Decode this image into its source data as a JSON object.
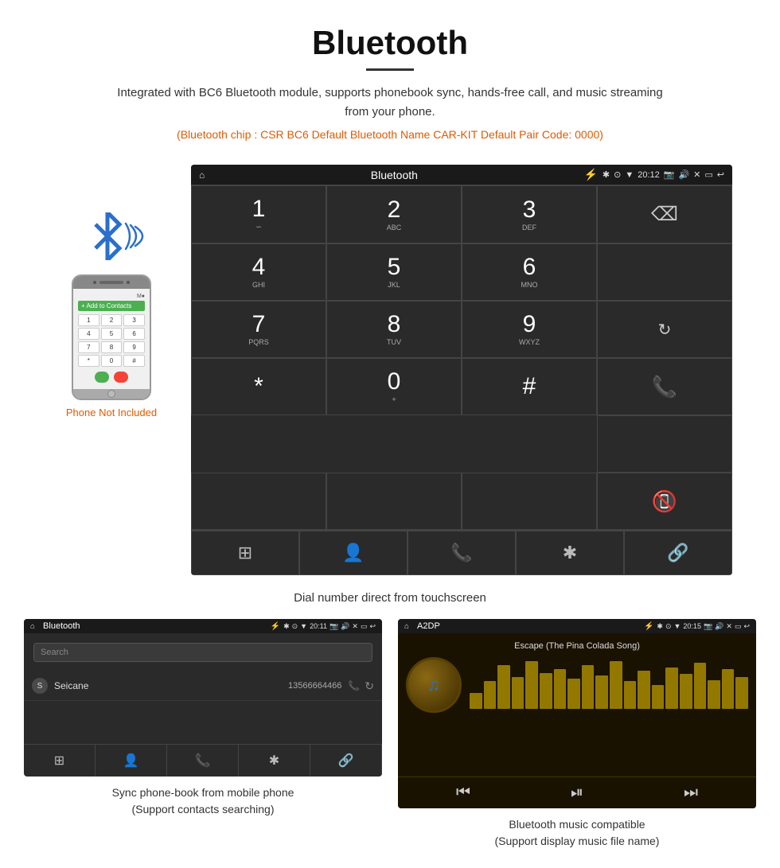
{
  "page": {
    "title": "Bluetooth",
    "subtitle": "Integrated with BC6 Bluetooth module, supports phonebook sync, hands-free call, and music streaming from your phone.",
    "specs": "(Bluetooth chip : CSR BC6    Default Bluetooth Name CAR-KIT    Default Pair Code: 0000)",
    "dial_caption": "Dial number direct from touchscreen",
    "phonebook_caption": "Sync phone-book from mobile phone\n(Support contacts searching)",
    "music_caption": "Bluetooth music compatible\n(Support display music file name)"
  },
  "android_screen": {
    "status_bar": {
      "home_icon": "⌂",
      "title": "Bluetooth",
      "usb_icon": "⚡",
      "bt_icon": "✱",
      "location_icon": "⊙",
      "signal_icon": "▼",
      "time": "20:12",
      "camera_icon": "📷",
      "volume_icon": "🔊",
      "x_icon": "✕",
      "window_icon": "▭",
      "back_icon": "↩"
    },
    "dial_keys": [
      {
        "number": "1",
        "sub": "∽"
      },
      {
        "number": "2",
        "sub": "ABC"
      },
      {
        "number": "3",
        "sub": "DEF"
      },
      {
        "number": "",
        "sub": "",
        "special": "backspace"
      },
      {
        "number": "4",
        "sub": "GHI"
      },
      {
        "number": "5",
        "sub": "JKL"
      },
      {
        "number": "6",
        "sub": "MNO"
      },
      {
        "number": "",
        "sub": "",
        "special": "empty"
      },
      {
        "number": "7",
        "sub": "PQRS"
      },
      {
        "number": "8",
        "sub": "TUV"
      },
      {
        "number": "9",
        "sub": "WXYZ"
      },
      {
        "number": "",
        "sub": "",
        "special": "refresh"
      },
      {
        "number": "*",
        "sub": ""
      },
      {
        "number": "0",
        "sub": "+"
      },
      {
        "number": "#",
        "sub": ""
      },
      {
        "number": "",
        "sub": "",
        "special": "green-call"
      },
      {
        "number": "",
        "sub": "",
        "special": "red-end"
      }
    ],
    "bottom_bar": [
      "grid",
      "person",
      "phone",
      "bluetooth",
      "link"
    ]
  },
  "phonebook_screen": {
    "status_bar_title": "Bluetooth",
    "time": "20:11",
    "search_placeholder": "Search",
    "contacts": [
      {
        "letter": "S",
        "name": "Seicane",
        "number": "13566664466"
      }
    ],
    "bottom_bar": [
      "grid",
      "person-active",
      "phone",
      "bluetooth",
      "link"
    ]
  },
  "music_screen": {
    "status_bar_title": "A2DP",
    "time": "20:15",
    "song_title": "Escape (The Pina Colada Song)",
    "eq_bars": [
      20,
      35,
      55,
      40,
      60,
      45,
      50,
      38,
      55,
      42,
      60,
      35,
      48,
      30,
      52,
      44,
      58,
      36,
      50,
      40
    ],
    "controls": [
      "prev",
      "play-pause",
      "next"
    ]
  },
  "phone_device": {
    "add_to_contacts": "+ Add to Contacts",
    "not_included": "Phone Not Included",
    "keys": [
      "1",
      "2",
      "3",
      "4",
      "5",
      "6",
      "7",
      "8",
      "9",
      "*",
      "0",
      "#"
    ]
  }
}
